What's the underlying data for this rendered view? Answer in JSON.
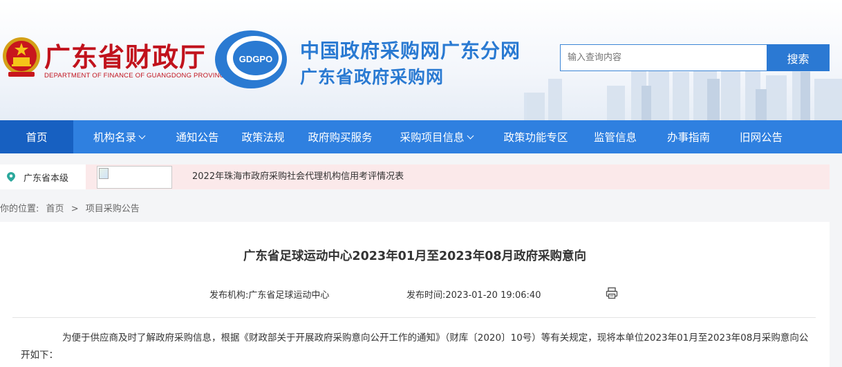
{
  "header": {
    "dept_name": "广东省财政厅",
    "dept_name_en": "DEPARTMENT OF FINANCE OF GUANGDONG PROVINCE",
    "logo_text": "GDGPO",
    "site_title": "中国政府采购网广东分网",
    "site_subtitle": "广东省政府采购网",
    "brand_red": "#c1121c",
    "brand_blue": "#2a7ad2"
  },
  "search": {
    "placeholder": "输入查询内容",
    "button_label": "搜索"
  },
  "nav": {
    "items": [
      {
        "label": "首页",
        "active": true
      },
      {
        "label": "机构名录",
        "dropdown": true
      },
      {
        "label": "通知公告"
      },
      {
        "label": "政策法规"
      },
      {
        "label": "政府购买服务"
      },
      {
        "label": "采购项目信息",
        "dropdown": true
      },
      {
        "label": "政策功能专区"
      },
      {
        "label": "监管信息"
      },
      {
        "label": "办事指南"
      },
      {
        "label": "旧网公告"
      }
    ],
    "bg_color": "#2f80e0",
    "active_color": "#1760c1"
  },
  "infobar": {
    "region": "广东省本级",
    "region_icon": "location-pin-icon",
    "ticker": "2022年珠海市政府采购社会代理机构信用考评情况表"
  },
  "breadcrumb": {
    "prefix": "你的位置:",
    "home": "首页",
    "separator": ">",
    "current": "项目采购公告"
  },
  "article": {
    "title": "广东省足球运动中心2023年01月至2023年08月政府采购意向",
    "publisher_label": "发布机构:",
    "publisher": "广东省足球运动中心",
    "time_label": "发布时间:",
    "time": "2023-01-20 19:06:40",
    "print_icon": "printer-icon",
    "body": "为便于供应商及时了解政府采购信息，根据《财政部关于开展政府采购意向公开工作的通知》（财库〔2020〕10号）等有关规定，现将本单位2023年01月至2023年08月采购意向公开如下："
  }
}
